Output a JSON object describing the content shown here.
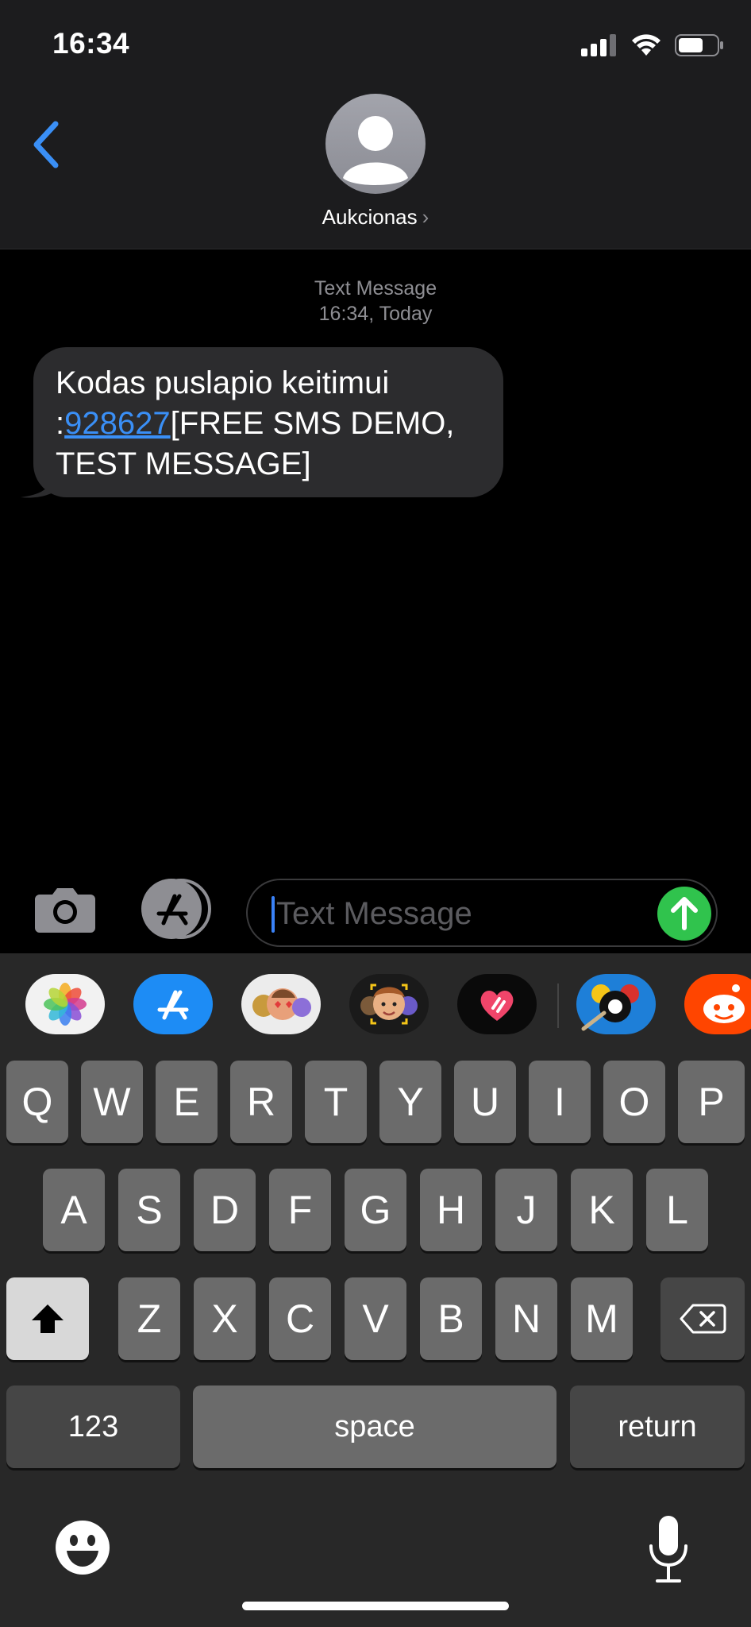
{
  "status_bar": {
    "time": "16:34"
  },
  "header": {
    "contact_name": "Aukcionas",
    "chevron": "›"
  },
  "conversation": {
    "type_label": "Text Message",
    "timestamp": "16:34, Today",
    "message": {
      "line1": "Kodas puslapio keitimui",
      "prefix": ":",
      "code_link": "928627",
      "suffix": "[FREE SMS DEMO,",
      "line3": "TEST MESSAGE]"
    }
  },
  "composer": {
    "placeholder": "Text Message"
  },
  "app_strip": [
    "photos-icon",
    "app-store-icon",
    "memoji-stickers-icon",
    "memoji-icon",
    "digital-touch-icon",
    "8-ball-pool-icon",
    "reddit-icon"
  ],
  "keyboard": {
    "row1": [
      "Q",
      "W",
      "E",
      "R",
      "T",
      "Y",
      "U",
      "I",
      "O",
      "P"
    ],
    "row2": [
      "A",
      "S",
      "D",
      "F",
      "G",
      "H",
      "J",
      "K",
      "L"
    ],
    "row3": [
      "Z",
      "X",
      "C",
      "V",
      "B",
      "N",
      "M"
    ],
    "numbers": "123",
    "space": "space",
    "return": "return"
  },
  "colors": {
    "accent": "#3a8ff6",
    "send": "#30c34d",
    "bubble": "#2c2c2e"
  }
}
